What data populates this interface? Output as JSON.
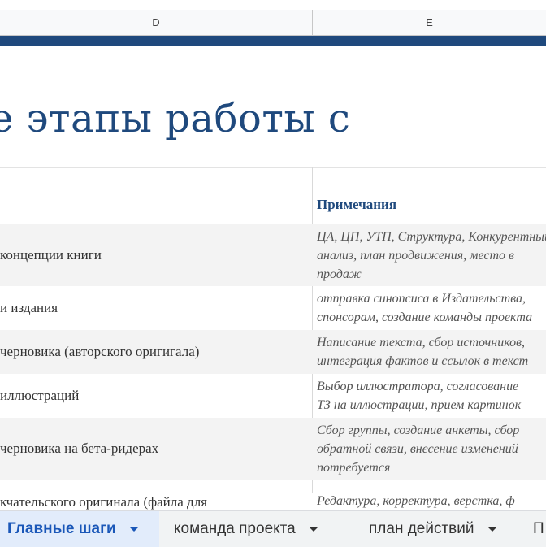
{
  "columns": [
    "D",
    "E"
  ],
  "title": "е этапы работы с",
  "header": {
    "notes": "Примечания"
  },
  "rows": [
    {
      "step": "концепции книги",
      "note": "ЦА, ЦП, УТП, Структура, Конкурентный\nанализ, план продвижения, место в\nпродаж"
    },
    {
      "step": "и издания",
      "note": "отправка синопсиса в Издательства,\nспонсорам, создание команды проекта"
    },
    {
      "step": "черновика (авторского оригигала)",
      "note": "Написание текста, сбор источников,\nинтеграция фактов и ссылок в текст"
    },
    {
      "step": "иллюстраций",
      "note": "Выбор иллюстратора, согласование\nТЗ на иллюстрации, прием картинок"
    },
    {
      "step": "черновика на бета-ридерах",
      "note": "Сбор группы, создание анкеты, сбор\nобратной связи, внесение изменений\nпотребуется"
    },
    {
      "step": "кчательского оригинала (файла для",
      "note": "Редактура, корректура, верстка, ф"
    }
  ],
  "sheet_tabs": [
    {
      "label": "Главные шаги",
      "active": true
    },
    {
      "label": "команда проекта",
      "active": false
    },
    {
      "label": "план действий",
      "active": false
    },
    {
      "label": "П",
      "active": false
    }
  ],
  "colors": {
    "accent": "#1f497d",
    "tab_active_bg": "#e2ecfb",
    "tab_active_text": "#1a57b8"
  }
}
